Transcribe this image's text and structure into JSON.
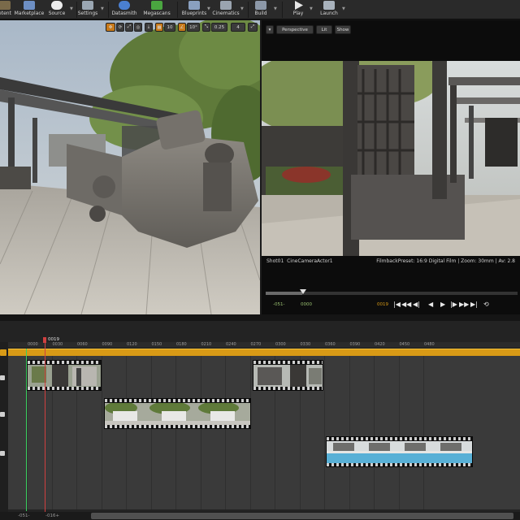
{
  "toolbar": {
    "items": [
      {
        "label": "etent",
        "icon": "content-icon"
      },
      {
        "label": "Marketplace",
        "icon": "marketplace-icon"
      },
      {
        "label": "Source",
        "icon": "source-control-icon"
      },
      {
        "label": "Settings",
        "icon": "settings-icon"
      },
      {
        "label": "Datasmith",
        "icon": "datasmith-icon"
      },
      {
        "label": "Megascans",
        "icon": "megascans-icon"
      },
      {
        "label": "Blueprints",
        "icon": "blueprints-icon"
      },
      {
        "label": "Cinematics",
        "icon": "cinematics-icon"
      },
      {
        "label": "Build",
        "icon": "build-icon"
      },
      {
        "label": "Play",
        "icon": "play-icon"
      },
      {
        "label": "Launch",
        "icon": "launch-icon"
      }
    ]
  },
  "left_viewport": {
    "tools": {
      "grid_snap": "10",
      "angle_snap": "10°",
      "scale_snap": "0.25",
      "camera_speed": "4"
    }
  },
  "right_viewport": {
    "perspective_label": "Perspective",
    "lit_label": "Lit",
    "show_label": "Show",
    "shot_label": "Shot01",
    "camera_label": "CineCameraActor1",
    "filmback_info": "FilmbackPreset: 16:9 Digital Film | Zoom: 30mm | Av: 2.8",
    "range_start": "-051-",
    "in_point": "0000",
    "current_frame": "0019",
    "controls": [
      "|◀",
      "◀◀",
      "◀|",
      "◀",
      "▶",
      "|▶",
      "▶▶",
      "▶|",
      "⟲"
    ]
  },
  "sequencer": {
    "playhead_label": "0019",
    "ruler_ticks": [
      "0000",
      "0030",
      "0060",
      "0090",
      "0120",
      "0150",
      "0180",
      "0210",
      "0240",
      "0270",
      "0300",
      "0330",
      "0360",
      "0390",
      "0420",
      "0450",
      "0480"
    ],
    "bottom_range_start": "-051-",
    "bottom_range_end": "-016+"
  },
  "colors": {
    "accent": "#d89a16",
    "playhead": "#d04040",
    "toolbar_bg": "#2a2a2a"
  }
}
